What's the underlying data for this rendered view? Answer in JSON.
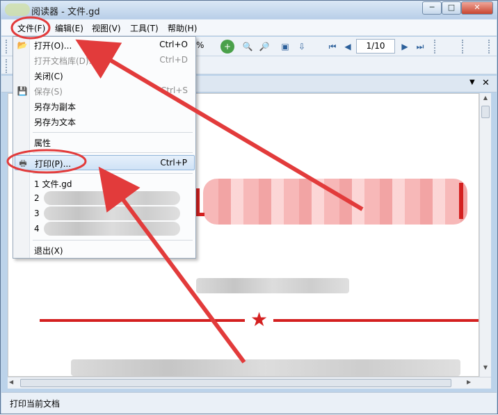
{
  "window": {
    "title": "阅读器 - 文件.gd",
    "minimize_glyph": "─",
    "maximize_glyph": "□",
    "close_glyph": "✕"
  },
  "menubar": {
    "items": [
      {
        "label": "文件(F)"
      },
      {
        "label": "编辑(E)"
      },
      {
        "label": "视图(V)"
      },
      {
        "label": "工具(T)"
      },
      {
        "label": "帮助(H)"
      }
    ]
  },
  "toolbar": {
    "zoom_value": "%",
    "page_indicator": "1/10",
    "icons": [
      "zoom-in-icon",
      "zoom-in-icon",
      "zoom-out-icon",
      "fit-page-icon",
      "fit-width-icon",
      "first-page-icon",
      "prev-page-icon",
      "next-page-icon",
      "last-page-icon"
    ]
  },
  "panel": {
    "dropdown_glyph": "▼",
    "close_glyph": "✕"
  },
  "file_menu": {
    "items": [
      {
        "label": "打开(O)...",
        "shortcut": "Ctrl+O",
        "icon": "folder-open-icon",
        "disabled": false
      },
      {
        "label": "打开文档库(D)...",
        "shortcut": "Ctrl+D",
        "icon": "",
        "disabled": true
      },
      {
        "label": "关闭(C)",
        "shortcut": "",
        "icon": "",
        "disabled": false
      },
      {
        "label": "保存(S)",
        "shortcut": "Ctrl+S",
        "icon": "save-icon",
        "disabled": true
      },
      {
        "label": "另存为副本",
        "shortcut": "",
        "icon": "",
        "disabled": false
      },
      {
        "label": "另存为文本",
        "shortcut": "",
        "icon": "",
        "disabled": false
      },
      {
        "label": "属性",
        "shortcut": "",
        "icon": "",
        "disabled": false
      },
      {
        "label": "打印(P)...",
        "shortcut": "Ctrl+P",
        "icon": "printer-icon",
        "disabled": false,
        "highlighted": true
      },
      {
        "label": "1 文件.gd",
        "shortcut": "",
        "icon": "",
        "disabled": false
      },
      {
        "label": "2",
        "shortcut": "",
        "icon": "",
        "disabled": false
      },
      {
        "label": "3",
        "shortcut": "",
        "icon": "",
        "disabled": false
      },
      {
        "label": "4",
        "shortcut": "",
        "icon": "",
        "disabled": false
      },
      {
        "label": "退出(X)",
        "shortcut": "",
        "icon": "",
        "disabled": false
      }
    ]
  },
  "document": {
    "heading_color": "#f08f8f",
    "rule_color": "#d42020",
    "star_glyph": "★"
  },
  "status": {
    "text": "打印当前文档"
  },
  "annotation_color": "#e23b3b"
}
